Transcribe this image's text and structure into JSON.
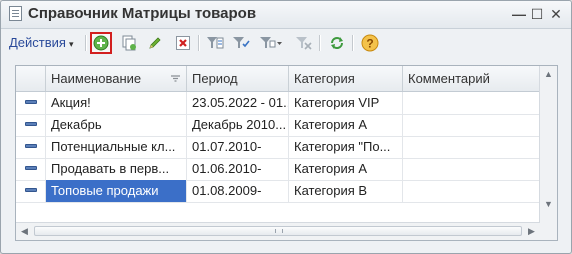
{
  "window": {
    "title": "Справочник Матрицы товаров",
    "min_glyph": "—",
    "max_glyph": "☐",
    "close_glyph": "✕"
  },
  "toolbar": {
    "actions_label": "Действия",
    "actions_caret": "▾",
    "buttons": [
      {
        "name": "add-button",
        "icon": "plus-circle-icon",
        "selected": true
      },
      {
        "name": "copy-button",
        "icon": "copy-icon"
      },
      {
        "name": "edit-button",
        "icon": "pencil-icon"
      },
      {
        "name": "delete-button",
        "icon": "delete-x-icon"
      },
      {
        "name": "filter-by-value-button",
        "icon": "filter-value-icon"
      },
      {
        "name": "filter-button",
        "icon": "filter-icon"
      },
      {
        "name": "filter-dropdown-button",
        "icon": "filter-dropdown-icon"
      },
      {
        "name": "clear-filter-button",
        "icon": "filter-clear-icon"
      },
      {
        "name": "refresh-button",
        "icon": "refresh-icon"
      },
      {
        "name": "help-button",
        "icon": "help-icon"
      }
    ]
  },
  "table": {
    "columns": [
      {
        "label": "Наименование",
        "sorted": true
      },
      {
        "label": "Период"
      },
      {
        "label": "Категория"
      },
      {
        "label": "Комментарий"
      }
    ],
    "rows": [
      {
        "name": "Акция!",
        "period": "23.05.2022 - 01...",
        "category": "Категория VIP",
        "comment": ""
      },
      {
        "name": "Декабрь",
        "period": "Декабрь 2010...",
        "category": "Категория А",
        "comment": ""
      },
      {
        "name": "Потенциальные кл...",
        "period": "01.07.2010-",
        "category": "Категория \"По...",
        "comment": ""
      },
      {
        "name": "Продавать в перв...",
        "period": "01.06.2010-",
        "category": "Категория А",
        "comment": ""
      },
      {
        "name": "Топовые продажи",
        "period": "01.08.2009-",
        "category": "Категория В",
        "comment": "",
        "selected": true
      }
    ]
  },
  "colors": {
    "selection": "#3b6fc8",
    "highlight_border": "#d21f1f",
    "accent_text": "#2a4a9a"
  }
}
